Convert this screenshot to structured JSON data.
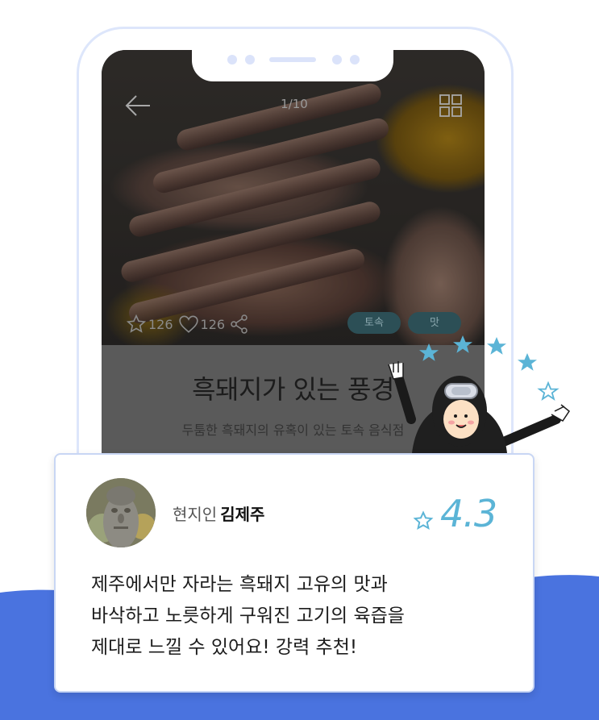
{
  "detail": {
    "counter": "1/10",
    "likes": "126",
    "hearts": "126",
    "tags": [
      "토속",
      "맛"
    ],
    "title": "흑돼지가 있는 풍경",
    "subtitle": "두툼한 흑돼지의 유혹이 있는 토속 음식점"
  },
  "review": {
    "reviewer_role": "현지인",
    "reviewer_name": "김제주",
    "rating": "4.3",
    "lines": [
      "제주에서만 자라는 흑돼지 고유의 맛과",
      "바삭하고 노릇하게 구워진 고기의 육즙을",
      "제대로 느낄 수 있어요! 강력 추천!"
    ]
  },
  "colors": {
    "brand_blue": "#4a73df",
    "rating_blue": "#5bb4d6",
    "tag_bg": "#2c4f56"
  },
  "icons": [
    "back-arrow-icon",
    "grid-icon",
    "star-outline-icon",
    "heart-outline-icon",
    "share-icon",
    "star-icon"
  ]
}
